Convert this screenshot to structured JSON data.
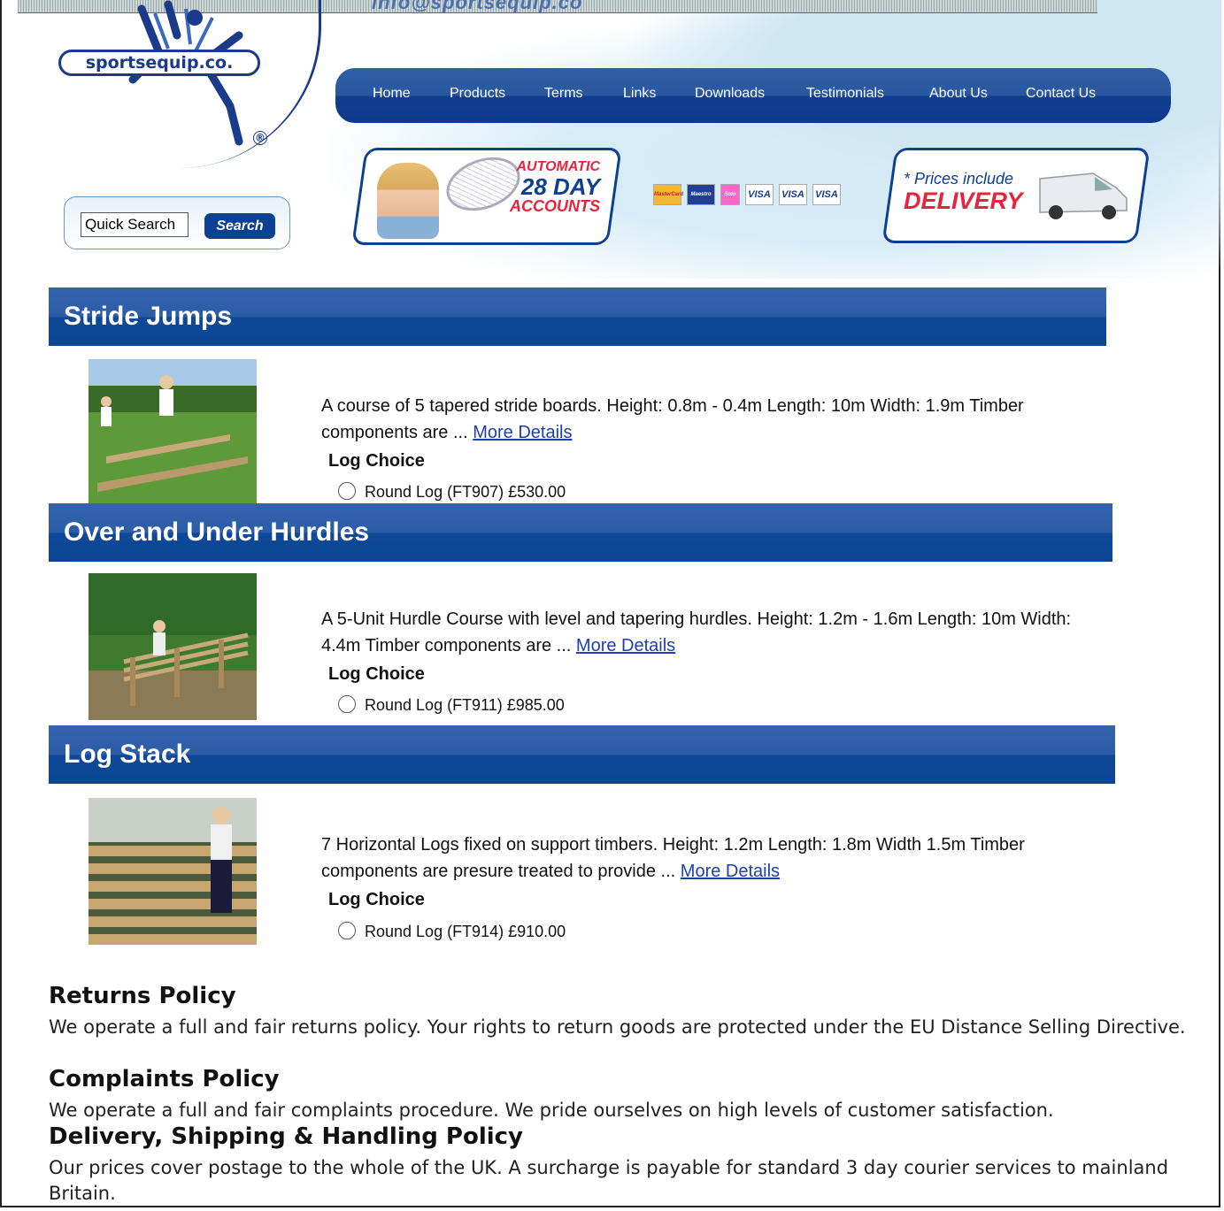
{
  "header": {
    "email_fragment": "info@sportsequip.co",
    "logo_text": "sportsequip.co.",
    "registered_mark": "®"
  },
  "nav": {
    "items": [
      "Home",
      "Products",
      "Terms",
      "Links",
      "Downloads",
      "Testimonials",
      "About Us",
      "Contact Us"
    ]
  },
  "search": {
    "value": "Quick Search",
    "button_label": "Search"
  },
  "banners": {
    "accounts": {
      "line1": "AUTOMATIC",
      "line2": "28 DAY",
      "line3": "ACCOUNTS"
    },
    "delivery": {
      "line1": "* Prices include",
      "line2": "DELIVERY"
    },
    "cards": [
      "MasterCard",
      "Maestro",
      "Solo",
      "VISA",
      "VISA",
      "VISA"
    ]
  },
  "products": [
    {
      "title": "Stride Jumps",
      "description": "A course of 5 tapered stride boards. Height: 0.8m - 0.4m Length: 10m Width: 1.9m Timber components are ...",
      "more_label": "More Details",
      "choice_label": "Log Choice",
      "option": "Round Log (FT907) £530.00"
    },
    {
      "title": "Over and Under Hurdles",
      "description": "A 5-Unit Hurdle Course with level and tapering hurdles. Height: 1.2m - 1.6m Length: 10m Width: 4.4m Timber components are ...",
      "more_label": "More Details",
      "choice_label": "Log Choice",
      "option": "Round Log (FT911) £985.00"
    },
    {
      "title": "Log Stack",
      "description": "7 Horizontal Logs fixed on support timbers. Height: 1.2m Length: 1.8m Width 1.5m Timber components are presure treated to provide ...",
      "more_label": "More Details",
      "choice_label": "Log Choice",
      "option": "Round Log (FT914) £910.00"
    }
  ],
  "policies": [
    {
      "title": "Returns Policy",
      "text": "We operate a full and fair returns policy.  Your rights to return goods are protected under the EU Distance Selling Directive."
    },
    {
      "title": "Complaints Policy",
      "text": "We operate a full and fair complaints procedure.  We pride ourselves on high levels of customer satisfaction."
    },
    {
      "title": "Delivery, Shipping & Handling Policy",
      "text": "Our prices cover postage to the whole of the UK.  A surcharge is payable for standard 3 day courier services to mainland Britain."
    }
  ],
  "colors": {
    "brand_blue": "#0d3f93",
    "accent_red": "#e8233b",
    "link": "#1f3fb0"
  }
}
